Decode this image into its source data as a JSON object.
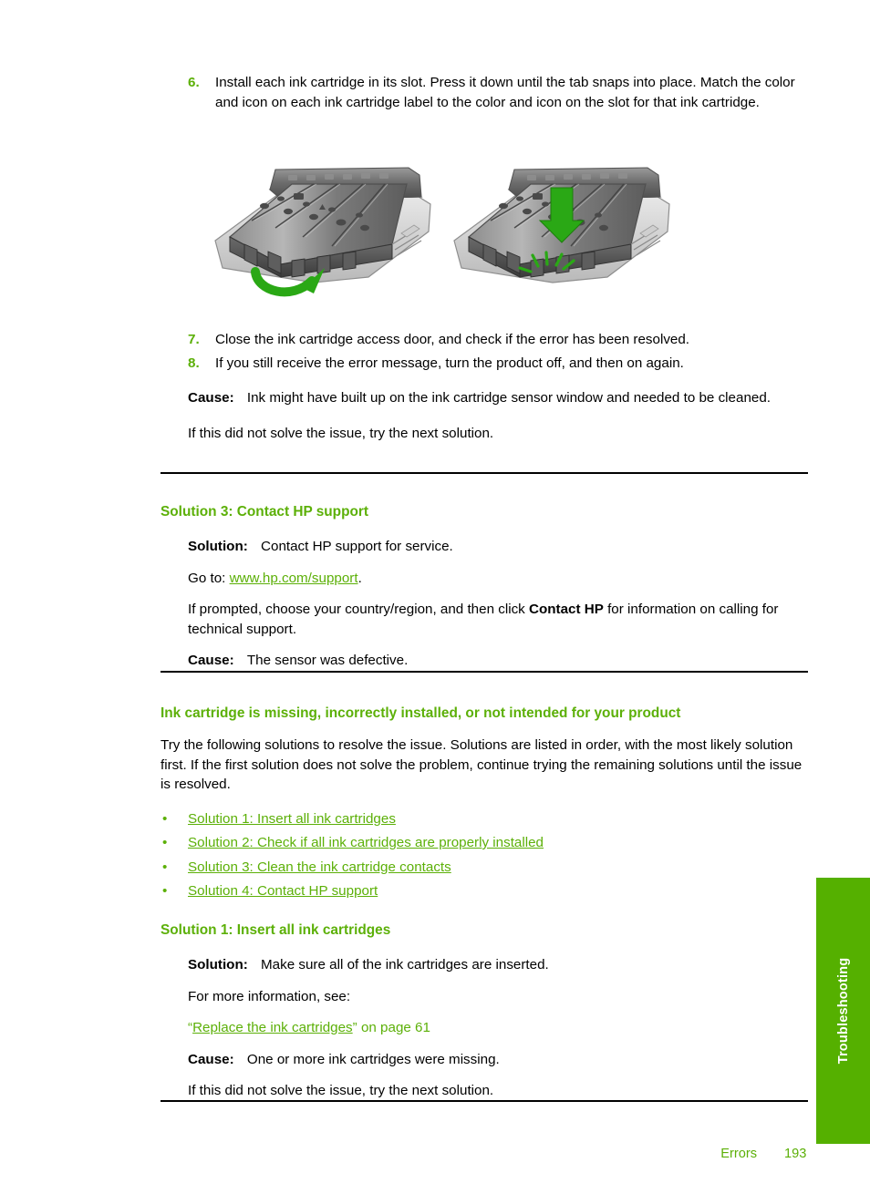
{
  "document": {
    "footer": {
      "section": "Errors",
      "page_number": "193"
    },
    "side_tab": {
      "label": "Troubleshooting",
      "color": "#55b000"
    },
    "accent_color": "#5cb008"
  },
  "steps": [
    {
      "number": "6.",
      "text": "Install each ink cartridge in its slot. Press it down until the tab snaps into place. Match the color and icon on each ink cartridge label to the color and icon on the slot for that ink cartridge."
    },
    {
      "number": "7.",
      "text": "Close the ink cartridge access door, and check if the error has been resolved."
    },
    {
      "number": "8.",
      "text": "If you still receive the error message, turn the product off, and then on again."
    }
  ],
  "figures": {
    "left": {
      "name": "printhead-latch-open-illustration",
      "caption": "Printhead carriage with green curved arrow showing cartridge insertion direction",
      "arrow_color": "#2aa815"
    },
    "right": {
      "name": "printhead-press-down-illustration",
      "caption": "Printhead carriage with green downward arrow and snap burst showing pressing cartridge into place",
      "arrow_color": "#2aa815"
    }
  },
  "section_sensor": {
    "cause_label": "Cause:",
    "cause_text": "Ink might have built up on the ink cartridge sensor window and needed to be cleaned.",
    "next_solution": "If this did not solve the issue, try the next solution."
  },
  "solution3": {
    "heading": "Solution 3: Contact HP support",
    "solution_label": "Solution:",
    "solution_text": "Contact HP support for service.",
    "goto_prefix": "Go to: ",
    "goto_link": "www.hp.com/support",
    "goto_suffix": ".",
    "prompt_before": "If prompted, choose your country/region, and then click ",
    "prompt_bold": "Contact HP",
    "prompt_after": " for information on calling for technical support.",
    "cause_label": "Cause:",
    "cause_text": "The sensor was defective."
  },
  "topic": {
    "heading": "Ink cartridge is missing, incorrectly installed, or not intended for your product",
    "intro": "Try the following solutions to resolve the issue. Solutions are listed in order, with the most likely solution first. If the first solution does not solve the problem, continue trying the remaining solutions until the issue is resolved.",
    "bullet_glyph": "•",
    "links": [
      "Solution 1: Insert all ink cartridges",
      "Solution 2: Check if all ink cartridges are properly installed",
      "Solution 3: Clean the ink cartridge contacts",
      "Solution 4: Contact HP support"
    ]
  },
  "solution1": {
    "heading": "Solution 1: Insert all ink cartridges",
    "solution_label": "Solution:",
    "solution_text": "Make sure all of the ink cartridges are inserted.",
    "more_info": "For more information, see:",
    "xref_open_quote": "“",
    "xref_link": "Replace the ink cartridges",
    "xref_close_quote": "”",
    "xref_suffix": " on page 61",
    "cause_label": "Cause:",
    "cause_text": "One or more ink cartridges were missing.",
    "next_solution": "If this did not solve the issue, try the next solution."
  }
}
